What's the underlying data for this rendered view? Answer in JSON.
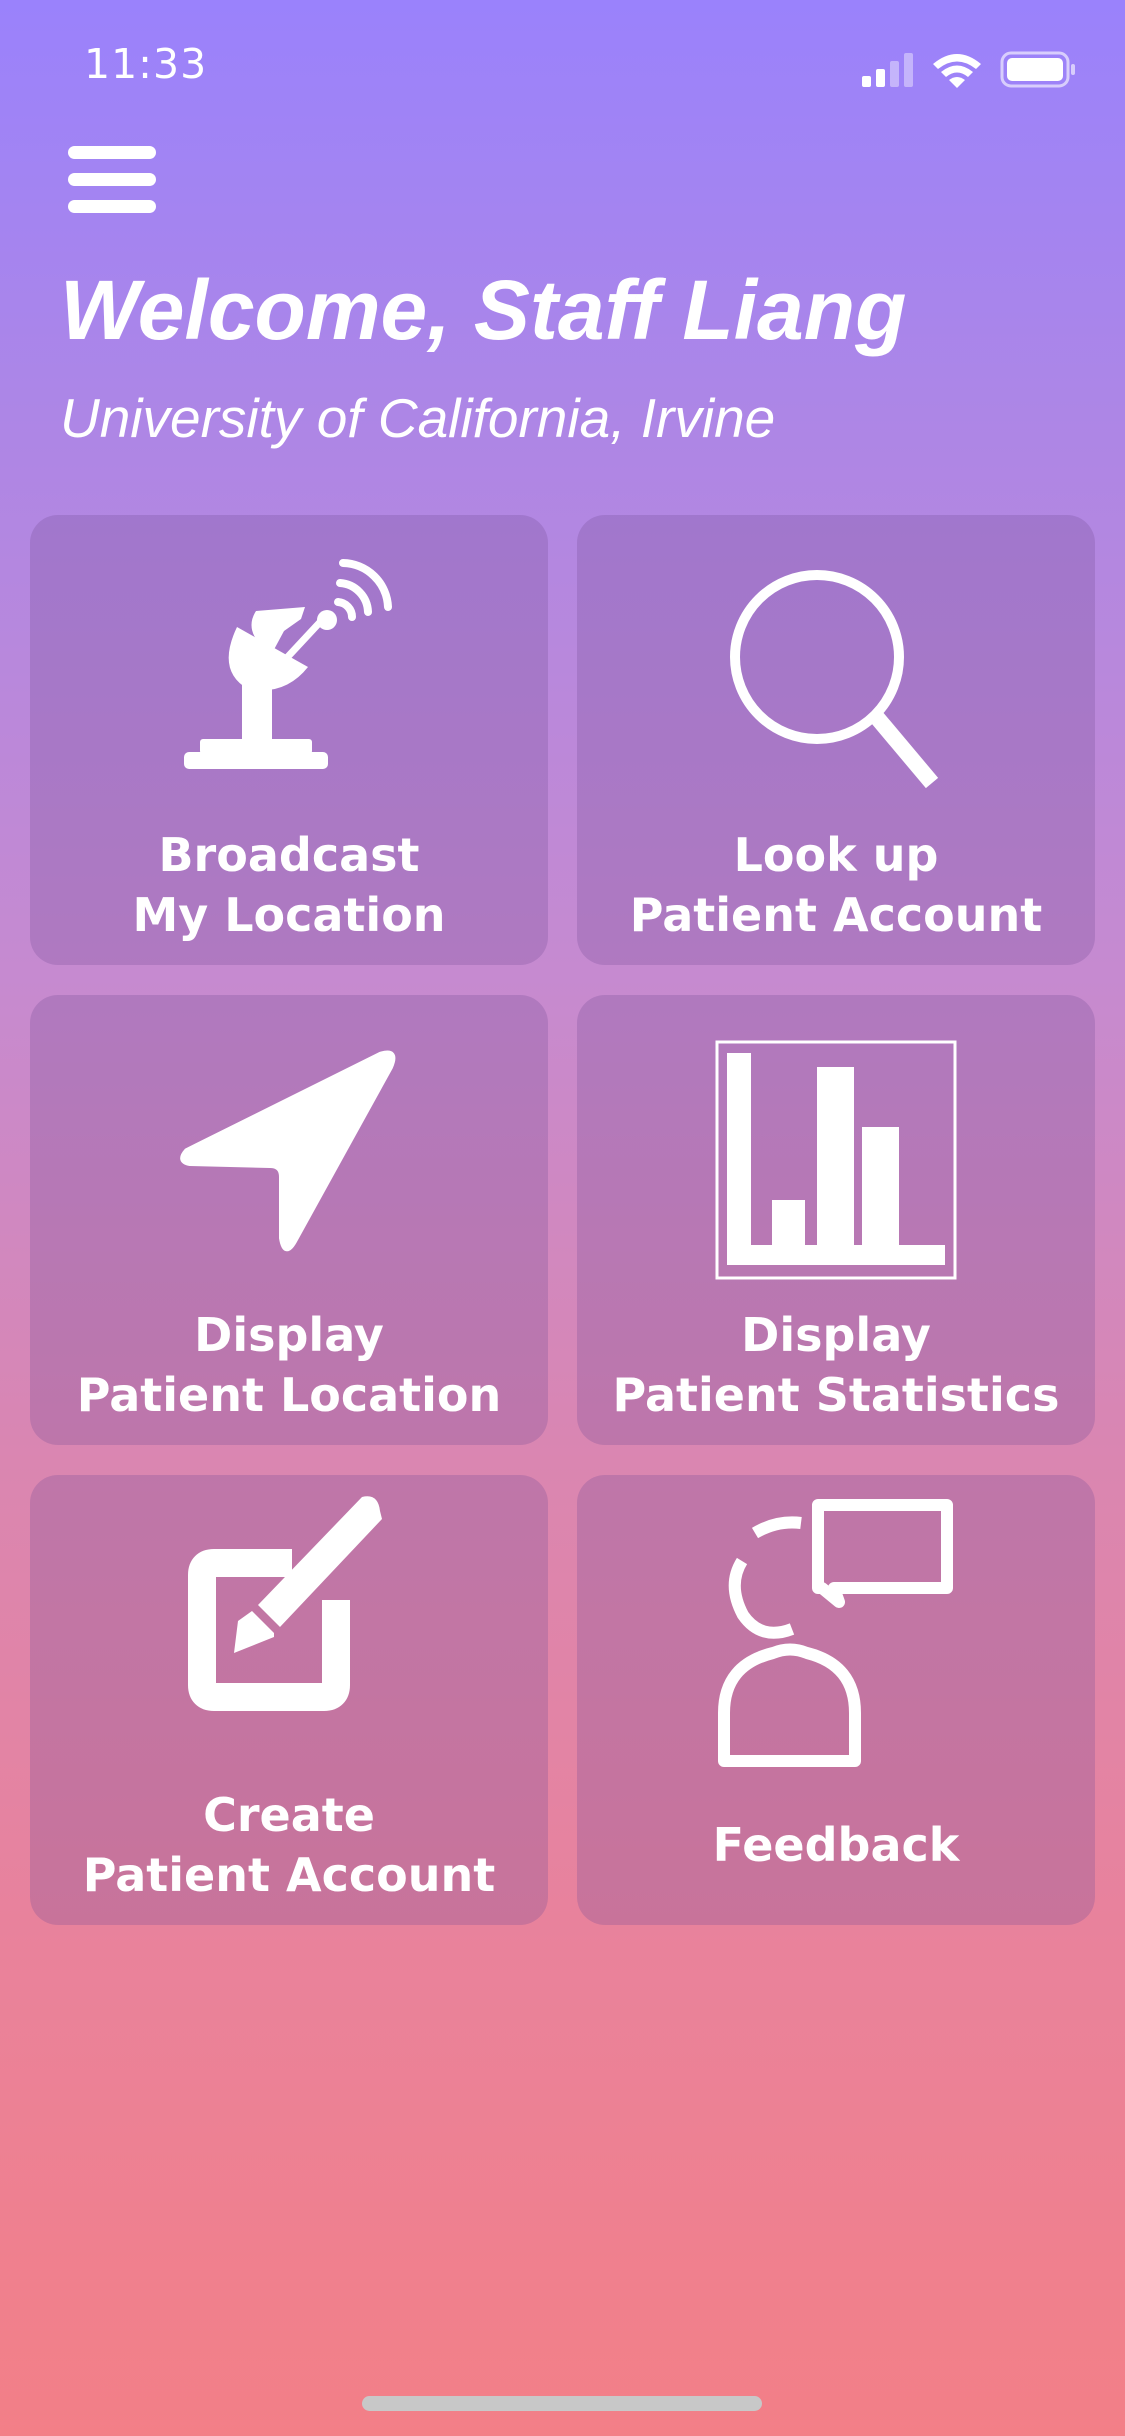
{
  "status_bar": {
    "time": "11:33",
    "icons": [
      "cellular-signal-icon",
      "wifi-icon",
      "battery-icon"
    ]
  },
  "header": {
    "menu_icon": "hamburger-menu-icon",
    "title": "Welcome, Staff Liang",
    "subtitle": "University of California, Irvine"
  },
  "tiles": [
    {
      "icon": "satellite-dish-icon",
      "line1": "Broadcast",
      "line2": "My Location"
    },
    {
      "icon": "magnifier-icon",
      "line1": "Look up",
      "line2": "Patient Account"
    },
    {
      "icon": "location-arrow-icon",
      "line1": "Display",
      "line2": "Patient Location"
    },
    {
      "icon": "bar-chart-icon",
      "line1": "Display",
      "line2": "Patient Statistics"
    },
    {
      "icon": "edit-pencil-icon",
      "line1": "Create",
      "line2": "Patient Account"
    },
    {
      "icon": "feedback-person-icon",
      "line1": "Feedback"
    }
  ],
  "colors": {
    "gradient_top": "#9a82fc",
    "gradient_bottom": "#f37f87",
    "tile_background": "rgba(120,80,150,0.28)",
    "foreground": "#ffffff"
  }
}
